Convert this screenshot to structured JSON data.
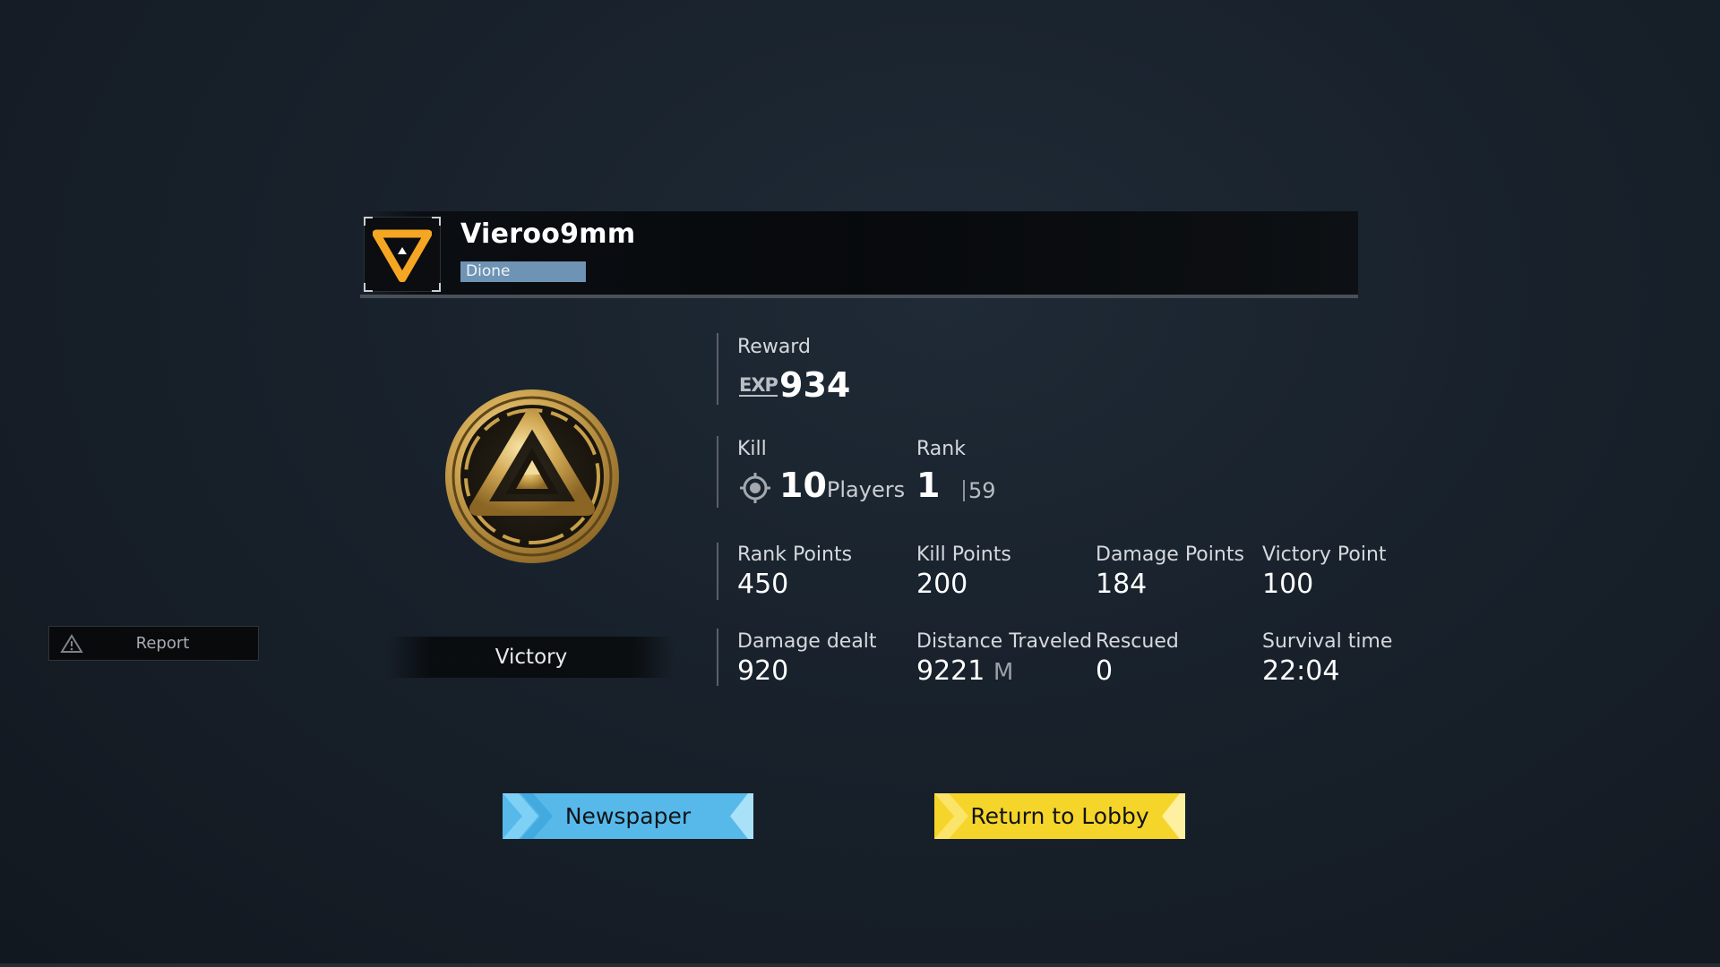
{
  "player": {
    "name": "Vieroo9mm",
    "server": "Dione",
    "avatar_icon": "orange-triangle-emblem-icon"
  },
  "result": {
    "medal_icon": "gold-triangle-medal-icon",
    "title": "Victory"
  },
  "report": {
    "icon": "warning-icon",
    "label": "Report"
  },
  "reward": {
    "label": "Reward",
    "exp_badge": "EXP",
    "exp_value": "934"
  },
  "kill": {
    "label": "Kill",
    "icon": "crosshair-icon",
    "value": "10",
    "unit": "Players"
  },
  "rank": {
    "label": "Rank",
    "value": "1",
    "total": "59"
  },
  "points": [
    {
      "label": "Rank Points",
      "value": "450"
    },
    {
      "label": "Kill Points",
      "value": "200"
    },
    {
      "label": "Damage Points",
      "value": "184"
    },
    {
      "label": "Victory Point",
      "value": "100"
    }
  ],
  "details": [
    {
      "label": "Damage dealt",
      "value": "920",
      "unit": ""
    },
    {
      "label": "Distance Traveled",
      "value": "9221",
      "unit": "M"
    },
    {
      "label": "Rescued",
      "value": "0",
      "unit": ""
    },
    {
      "label": "Survival time",
      "value": "22:04",
      "unit": ""
    }
  ],
  "buttons": {
    "newspaper": "Newspaper",
    "return_lobby": "Return to Lobby"
  },
  "colors": {
    "newspaper_button": "#56b9ea",
    "lobby_button": "#f6d52a",
    "server_tag": "#6f93b4",
    "emblem_orange": "#f5a623",
    "medal_gold": "#d9b35a"
  }
}
